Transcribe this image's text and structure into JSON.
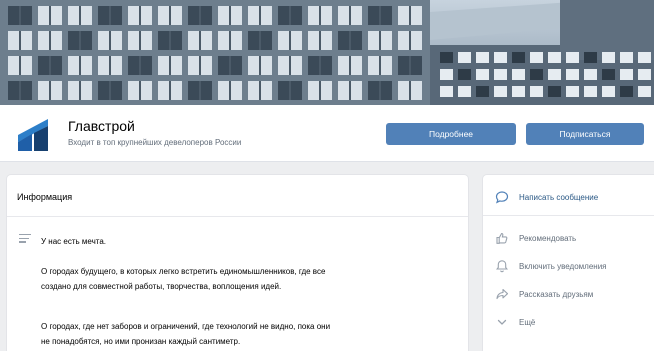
{
  "cover": {},
  "group": {
    "name": "Главстрой",
    "description": "Входит в топ крупнейших девелоперов России",
    "logo_colors": [
      "#1f5fa8",
      "#2d7fc9",
      "#17406f"
    ]
  },
  "buttons": {
    "details": "Подробнее",
    "subscribe": "Подписаться"
  },
  "info": {
    "title": "Информация",
    "paragraphs": [
      [
        "У нас есть мечта."
      ],
      [
        "О городах будущего, в которых легко встретить единомышленников, где все",
        "создано для совместной работы, творчества, воплощения идей."
      ],
      [
        "О городах, где нет заборов и ограничений, где технологий не видно, пока они",
        "не понадобятся, но ими пронизан каждый сантиметр."
      ]
    ]
  },
  "actions": [
    {
      "label": "Написать сообщение",
      "icon": "message-icon",
      "primary": true
    },
    {
      "label": "Рекомендовать",
      "icon": "thumbs-up-icon"
    },
    {
      "label": "Включить уведомления",
      "icon": "bell-icon"
    },
    {
      "label": "Рассказать друзьям",
      "icon": "share-icon"
    },
    {
      "label": "Ещё",
      "icon": "chevron-down-icon"
    }
  ],
  "colors": {
    "accent": "#5181b8",
    "link": "#2a5885",
    "muted": "#626d7a",
    "background": "#edeef0"
  }
}
